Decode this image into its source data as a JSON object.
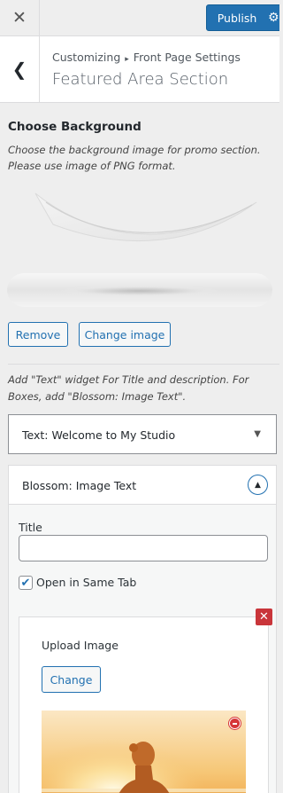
{
  "header": {
    "close_icon": "close-icon",
    "publish_label": "Publish",
    "settings_icon": "gear-icon",
    "accent": "#2271b1"
  },
  "section": {
    "back_icon": "chevron-left-icon",
    "breadcrumb_root": "Customizing",
    "breadcrumb_separator": "▸",
    "breadcrumb_parent": "Front Page Settings",
    "title": "Featured Area Section"
  },
  "background_control": {
    "title": "Choose Background",
    "description": "Choose the background image for promo section. Please use image of PNG format.",
    "remove_label": "Remove",
    "change_label": "Change image"
  },
  "widget_note": "Add \"Text\" widget For Title and description. For Boxes, add \"Blossom: Image Text\".",
  "widgets": [
    {
      "prefix": "Text:",
      "name": "Welcome to My Studio",
      "expanded": false
    },
    {
      "prefix": "",
      "name": "Blossom: Image Text",
      "expanded": true,
      "title_label": "Title",
      "title_value": "",
      "open_same_tab_label": "Open in Same Tab",
      "open_same_tab_checked": true,
      "upload_label": "Upload Image",
      "upload_change_label": "Change"
    }
  ]
}
